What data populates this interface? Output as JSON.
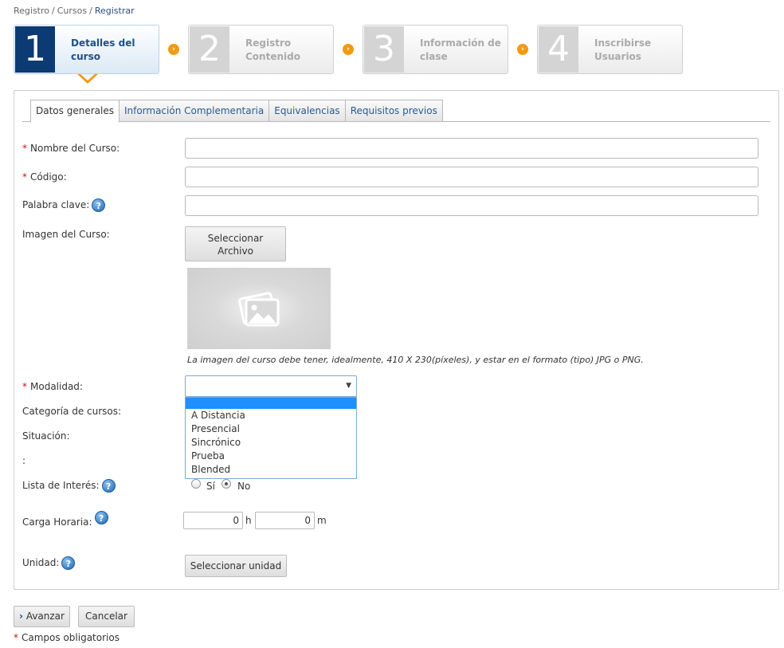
{
  "breadcrumb": {
    "items": [
      "Registro",
      "Cursos"
    ],
    "current": "Registrar",
    "separator": "/"
  },
  "wizard": {
    "steps": [
      {
        "number": "1",
        "line1": "Detalles del",
        "line2": "curso",
        "active": true
      },
      {
        "number": "2",
        "line1": "Registro",
        "line2": "Contenido",
        "active": false
      },
      {
        "number": "3",
        "line1": "Información de",
        "line2": "clase",
        "active": false
      },
      {
        "number": "4",
        "line1": "Inscribirse",
        "line2": "Usuarios",
        "active": false
      }
    ]
  },
  "tabs": [
    {
      "label": "Datos generales",
      "active": true
    },
    {
      "label": "Información Complementaria",
      "active": false
    },
    {
      "label": "Equivalencias",
      "active": false
    },
    {
      "label": "Requisitos previos",
      "active": false
    }
  ],
  "form": {
    "required_mark": "*",
    "nombre_label": "Nombre del Curso:",
    "nombre_value": "",
    "codigo_label": "Código:",
    "codigo_value": "",
    "palabra_label": "Palabra clave:",
    "palabra_value": "",
    "imagen_label": "Imagen del Curso:",
    "imagen_button_line1": "Seleccionar",
    "imagen_button_line2": "Archivo",
    "imagen_note": "La imagen del curso debe tener, idealmente, 410 X 230(píxeles), y estar en el formato (tipo) JPG o PNG.",
    "modalidad_label": "Modalidad:",
    "modalidad_value": "",
    "modalidad_options": [
      "",
      "A Distancia",
      "Presencial",
      "Sincrónico",
      "Prueba",
      "Blended"
    ],
    "categoria_label": "Categoría de cursos:",
    "situacion_label": "Situación:",
    "colon_label": ":",
    "lista_label": "Lista de Interés:",
    "lista_si": "Sí",
    "lista_no": "No",
    "lista_selected": "No",
    "carga_label": "Carga Horaria:",
    "carga_hours": "0",
    "carga_hours_unit": "h",
    "carga_minutes": "0",
    "carga_minutes_unit": "m",
    "unidad_label": "Unidad:",
    "unidad_button": "Seleccionar unidad",
    "help_glyph": "?"
  },
  "actions": {
    "avanzar": "Avanzar",
    "avanzar_glyph": "›",
    "cancelar": "Cancelar"
  },
  "footnote": {
    "mark": "*",
    "text": "Campos obligatorios"
  },
  "colors": {
    "accent": "#f29a14",
    "active_step": "#0c3a73",
    "link": "#2a5a8c",
    "required": "#cc1111",
    "dropdown_highlight": "#1e90ff"
  }
}
